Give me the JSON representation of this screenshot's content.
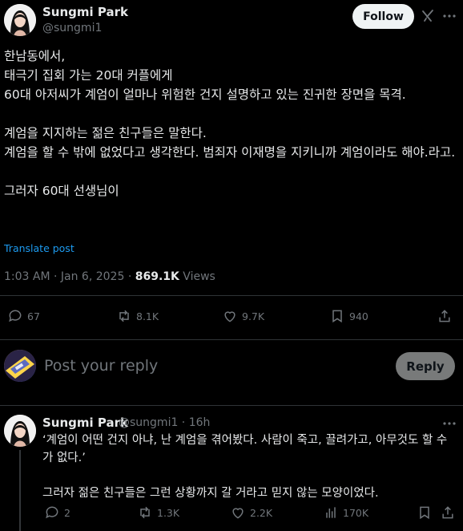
{
  "post": {
    "author_name": "Sungmi Park",
    "author_handle": "@sungmi1",
    "follow_label": "Follow",
    "text": "한남동에서,\n태극기 집회 가는 20대 커플에게\n60대 아저씨가 계엄이 얼마나 위험한 건지 설명하고 있는 진귀한 장면을 목격.\n\n계엄을 지지하는 젊은 친구들은 말한다.\n계엄을 할 수 밖에 없었다고 생각한다. 범죄자 이재명을 지키니까 계엄이라도 해야.라고.\n\n그러자 60대 선생님이",
    "translate_label": "Translate post",
    "time": "1:03 AM · Jan 6, 2025 · ",
    "views_count": "869.1K",
    "views_label": " Views",
    "actions": {
      "replies": "67",
      "reposts": "8.1K",
      "likes": "9.7K",
      "bookmarks": "940"
    }
  },
  "composer": {
    "placeholder": "Post your reply",
    "reply_label": "Reply"
  },
  "reply": {
    "author_name": "Sungmi Park",
    "author_handle": "@sungmi1 · 16h",
    "text": "‘계엄이 어떤 건지 아냐, 난 계엄을 겪어봤다. 사람이 죽고, 끌려가고, 아무것도 할 수가 없다.’\n\n그러자 젊은 친구들은 그런 상황까지 갈 거라고 믿지 않는 모양이었다.",
    "actions": {
      "replies": "2",
      "reposts": "1.3K",
      "likes": "2.2K",
      "views": "170K"
    }
  },
  "colors": {
    "background": "#000000",
    "text": "#e7e9ea",
    "muted": "#71767b",
    "link": "#1d9bf0",
    "divider": "#2f3336"
  }
}
